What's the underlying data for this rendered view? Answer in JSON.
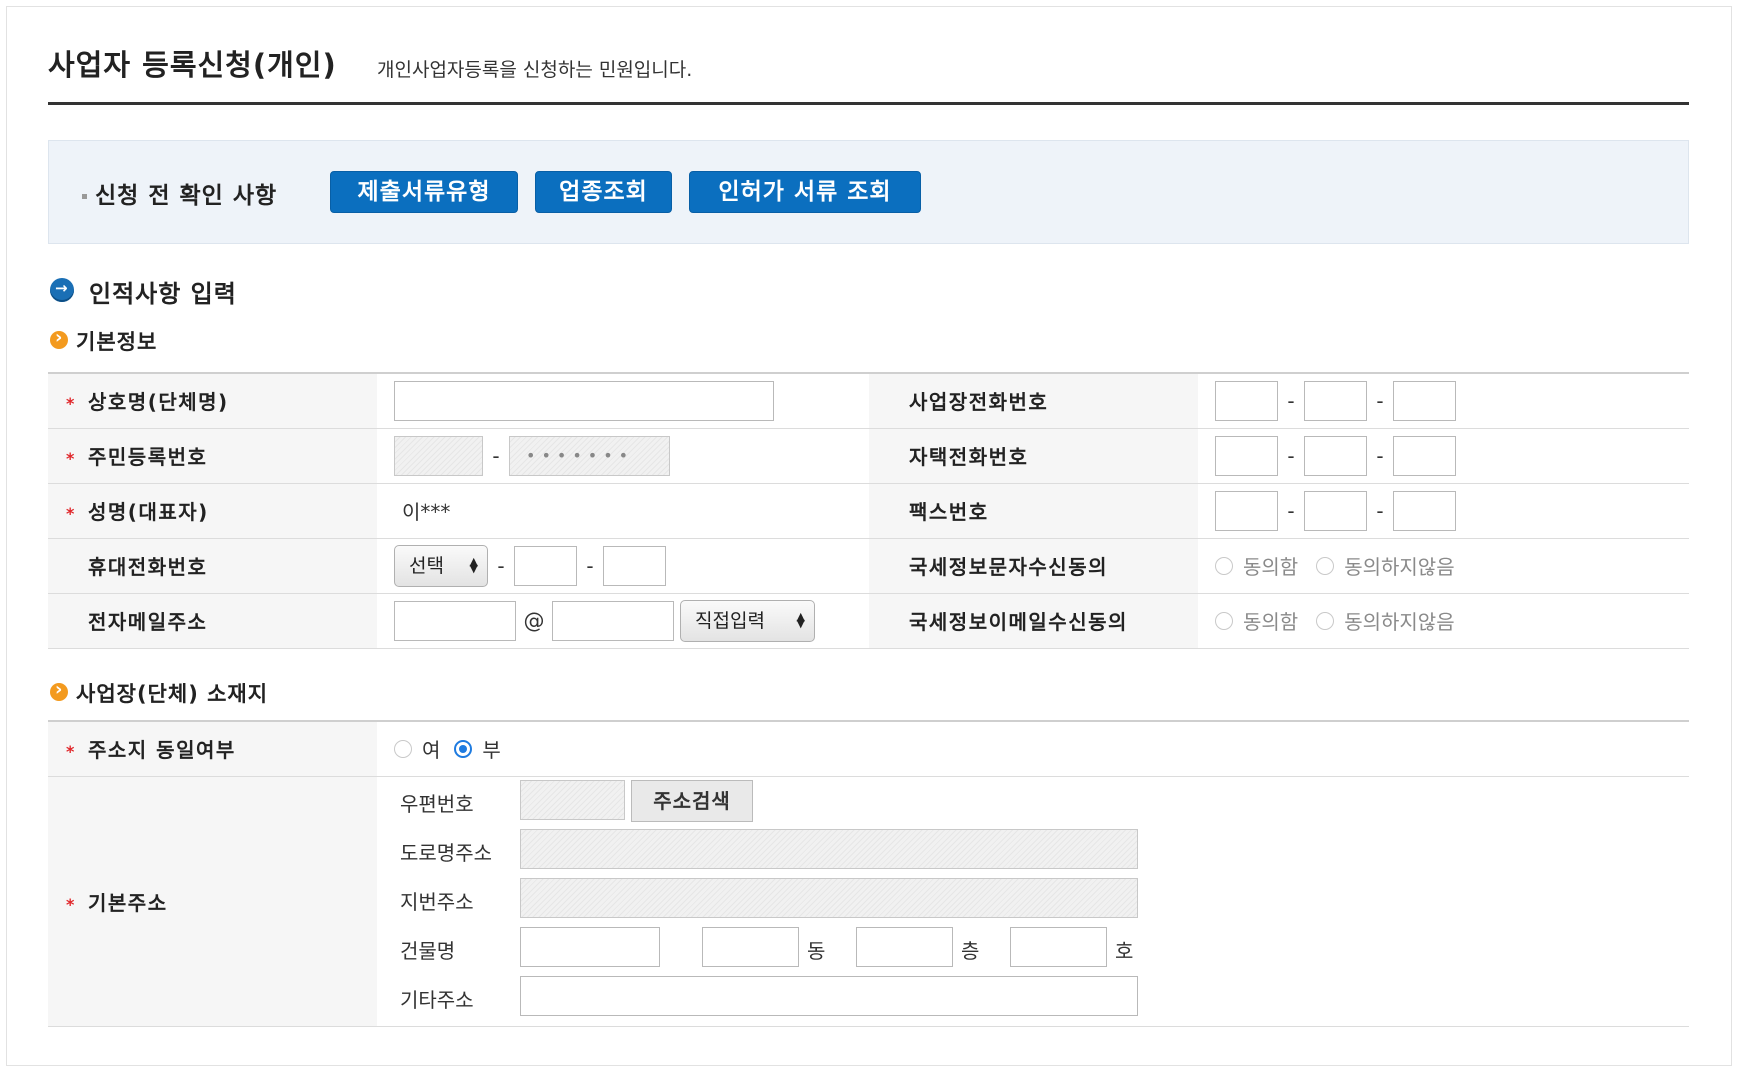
{
  "header": {
    "title": "사업자 등록신청(개인)",
    "description": "개인사업자등록을 신청하는 민원입니다."
  },
  "notice": {
    "label": "신청 전 확인 사항",
    "buttons": [
      "제출서류유형",
      "업종조회",
      "인허가 서류 조회"
    ]
  },
  "section": {
    "title": "인적사항 입력"
  },
  "basic_info": {
    "title": "기본정보",
    "trade_name_label": "상호명(단체명)",
    "resident_no_label": "주민등록번호",
    "resident_no_mask": "•••••••",
    "name_label": "성명(대표자)",
    "name_value": "이***",
    "mobile_label": "휴대전화번호",
    "mobile_select": "선택",
    "email_label": "전자메일주소",
    "email_at": "@",
    "email_domain_select": "직접입력",
    "biz_phone_label": "사업장전화번호",
    "home_phone_label": "자택전화번호",
    "fax_label": "팩스번호",
    "sms_consent_label": "국세정보문자수신동의",
    "email_consent_label": "국세정보이메일수신동의",
    "agree": "동의함",
    "disagree": "동의하지않음",
    "dash": "-"
  },
  "location": {
    "title": "사업장(단체) 소재지",
    "same_address_label": "주소지 동일여부",
    "yes": "여",
    "no": "부",
    "selected": "부",
    "base_address_label": "기본주소",
    "postal_label": "우편번호",
    "search_button": "주소검색",
    "road_label": "도로명주소",
    "lot_label": "지번주소",
    "building_label": "건물명",
    "dong": "동",
    "floor": "층",
    "ho": "호",
    "etc_label": "기타주소"
  },
  "colors": {
    "primary_button": "#0b6fbf",
    "notice_bg": "#eef3f9",
    "required_star": "#e0262a",
    "section_icon": "#1a6fb5",
    "sub_icon": "#f39a1f",
    "radio_selected": "#1e7be0"
  }
}
